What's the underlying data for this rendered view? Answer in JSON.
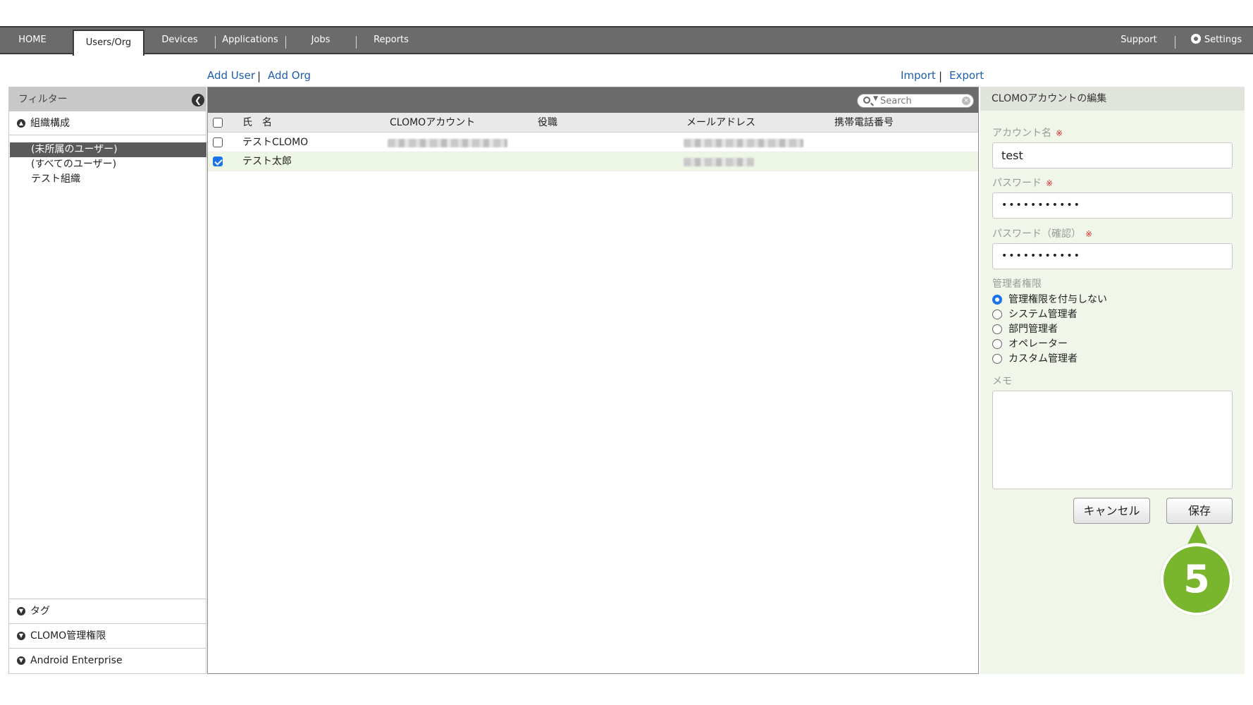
{
  "nav": {
    "tabs": [
      "HOME",
      "Users/Org",
      "Devices",
      "Applications",
      "Jobs",
      "Reports"
    ],
    "active_tab": "Users/Org",
    "support": "Support",
    "settings": "Settings"
  },
  "actions": {
    "add_user": "Add User",
    "add_org": "Add Org",
    "import": "Import",
    "export": "Export",
    "separator": "|"
  },
  "sidebar": {
    "filter_title": "フィルター",
    "org_section": "組織構成",
    "tree_items": [
      "(未所属のユーザー)",
      "(すべてのユーザー)",
      "テスト組織"
    ],
    "selected_item": "(未所属のユーザー)",
    "bottom_sections": [
      "タグ",
      "CLOMO管理権限",
      "Android Enterprise"
    ]
  },
  "list": {
    "search_placeholder": "Search",
    "columns": {
      "name": "氏　名",
      "account": "CLOMOアカウント",
      "title": "役職",
      "email": "メールアドレス",
      "phone": "携帯電話番号"
    },
    "rows": [
      {
        "name": "テストCLOMO",
        "checked": false
      },
      {
        "name": "テスト太郎",
        "checked": true
      }
    ]
  },
  "edit": {
    "title": "CLOMOアカウントの編集",
    "account_label": "アカウント名",
    "account_value": "test",
    "password_label": "パスワード",
    "password_value": "•••••••••••",
    "password_confirm_label": "パスワード（確認）",
    "password_confirm_value": "•••••••••••",
    "required_mark": "※",
    "admin_label": "管理者権限",
    "admin_options": [
      "管理権限を付与しない",
      "システム管理者",
      "部門管理者",
      "オペレーター",
      "カスタム管理者"
    ],
    "admin_selected": "管理権限を付与しない",
    "memo_label": "メモ",
    "memo_value": "",
    "cancel_button": "キャンセル",
    "save_button": "保存"
  },
  "callout": {
    "step": "5",
    "color": "#7ab52e"
  },
  "colors": {
    "nav_bg": "#6b6b6b",
    "link": "#1f5fa8",
    "panel_bg": "#f0f6e9",
    "accent": "#1a73e8"
  }
}
